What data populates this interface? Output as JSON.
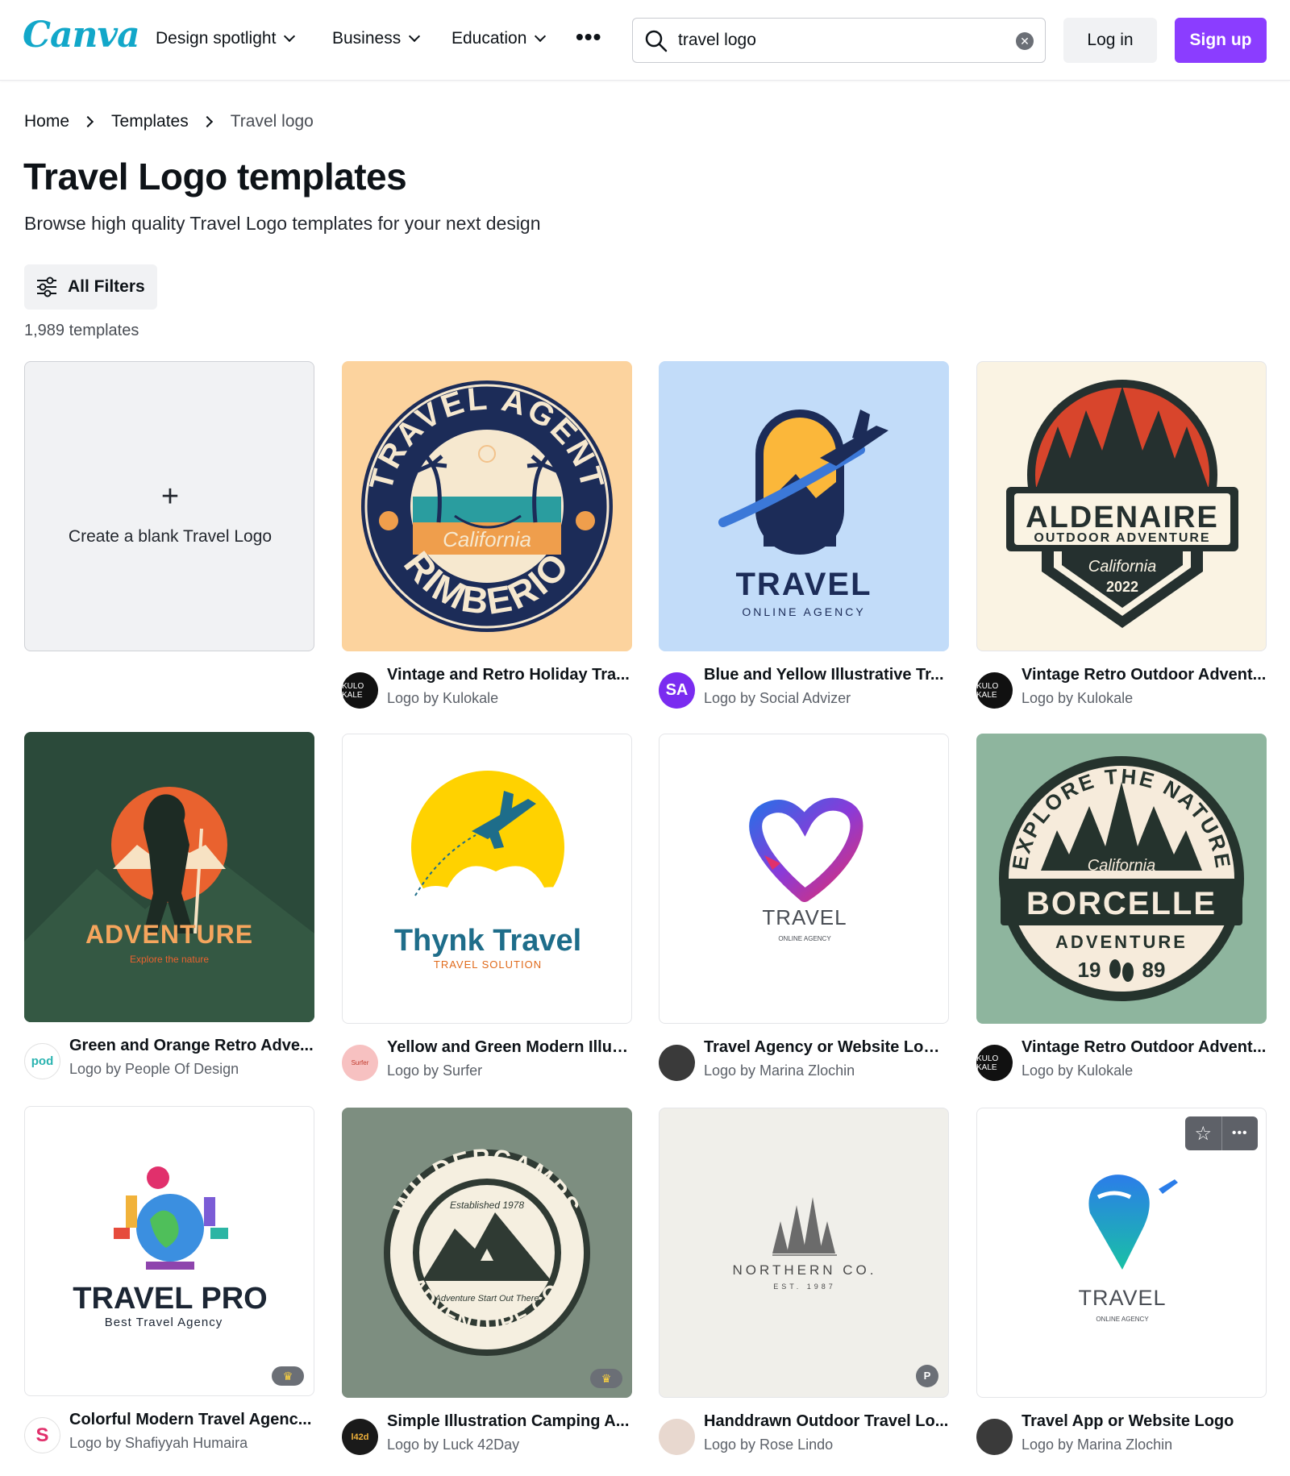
{
  "header": {
    "logo": "Canva",
    "nav": [
      "Design spotlight",
      "Business",
      "Education"
    ],
    "more_label": "•••",
    "search_value": "travel logo",
    "login_label": "Log in",
    "signup_label": "Sign up",
    "colors": {
      "brand": "#12a7c9",
      "signup": "#8b3dff"
    }
  },
  "breadcrumb": [
    "Home",
    "Templates",
    "Travel logo"
  ],
  "page": {
    "title": "Travel Logo templates",
    "subtitle": "Browse high quality Travel Logo templates for your next design",
    "filters_label": "All Filters",
    "count": "1,989 templates"
  },
  "blank": {
    "plus": "+",
    "label": "Create a blank Travel Logo"
  },
  "cards": [
    {
      "title": "Vintage and Retro Holiday Tra...",
      "author": "Logo by Kulokale"
    },
    {
      "title": "Blue and Yellow Illustrative Tr...",
      "author": "Logo by Social Advizer",
      "avatar_text": "SA"
    },
    {
      "title": "Vintage Retro Outdoor Advent...",
      "author": "Logo by Kulokale"
    },
    {
      "title": "Green and Orange Retro Adve...",
      "author": "Logo by People Of Design",
      "avatar_text": "pod"
    },
    {
      "title": "Yellow and Green Modern Illus...",
      "author": "Logo by Surfer",
      "avatar_text": "Surfer"
    },
    {
      "title": "Travel Agency or Website Logo...",
      "author": "Logo by Marina Zlochin"
    },
    {
      "title": "Vintage Retro Outdoor Advent...",
      "author": "Logo by Kulokale"
    },
    {
      "title": "Colorful Modern Travel Agenc...",
      "author": "Logo by Shafiyyah Humaira",
      "avatar_text": "S"
    },
    {
      "title": "Simple Illustration Camping A...",
      "author": "Logo by Luck 42Day",
      "avatar_text": "l42d"
    },
    {
      "title": "Handdrawn Outdoor Travel Lo...",
      "author": "Logo by Rose Lindo"
    },
    {
      "title": "Travel App or Website Logo",
      "author": "Logo by Marina Zlochin"
    }
  ],
  "kulokale_avatar_text": "KULO KALE",
  "logo_text": {
    "t1_top": "TRAVEL AGENT",
    "t1_bottom": "RIMBERIO",
    "t1_mid": "California",
    "t2_main": "TRAVEL",
    "t2_sub": "ONLINE AGENCY",
    "t3_main": "ALDENAIRE",
    "t3_sub": "OUTDOOR ADVENTURE",
    "t3_script": "California",
    "t3_year": "2022",
    "t4_main": "ADVENTURE",
    "t4_sub": "Explore the nature",
    "t5_main": "Thynk Travel",
    "t5_sub": "TRAVEL SOLUTION",
    "t6_main": "TRAVEL",
    "t6_sub": "ONLINE AGENCY",
    "t7_top": "EXPLORE THE NATURE",
    "t7_script": "California",
    "t7_main": "BORCELLE",
    "t7_sub": "ADVENTURE",
    "t7_year_a": "19",
    "t7_year_b": "89",
    "t8_main": "TRAVEL PRO",
    "t8_sub": "Best Travel Agency",
    "t9_top": "WILDERCAMPS",
    "t9_bottom": "ADVENTURE CO.",
    "t9_est": "Established 1978",
    "t9_script": "Adventure Start Out There",
    "t10_main": "NORTHERN CO.",
    "t10_sub": "EST. 1987",
    "t11_main": "TRAVEL",
    "t11_sub": "ONLINE AGENCY"
  },
  "badges": {
    "crown": "♛",
    "paid": "P"
  },
  "hover_actions": {
    "star": "☆",
    "more": "•••"
  }
}
